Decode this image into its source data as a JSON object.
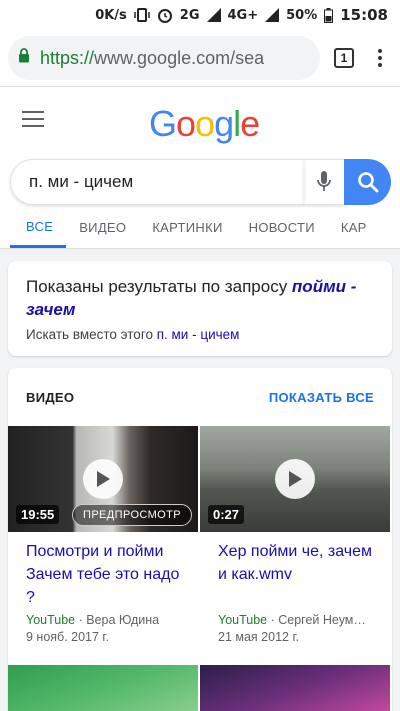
{
  "status": {
    "speed": "0K/s",
    "net1": "2G",
    "net2": "4G+",
    "battery": "50%",
    "time": "15:08"
  },
  "chrome": {
    "url_scheme": "https://",
    "url_rest": "www.google.com/sea",
    "tab_count": "1"
  },
  "search": {
    "query": "п. ми - цичем"
  },
  "tabs": [
    {
      "label": "ВСЕ"
    },
    {
      "label": "ВИДЕО"
    },
    {
      "label": "КАРТИНКИ"
    },
    {
      "label": "НОВОСТИ"
    },
    {
      "label": "КАР"
    }
  ],
  "spell": {
    "prefix": "Показаны результаты по запросу ",
    "corrected_1": "пойми",
    "corrected_2": "- зачем",
    "alt_prefix": "Искать вместо этого ",
    "alt_query": "п. ми - цичем"
  },
  "videos": {
    "heading": "ВИДЕО",
    "show_all": "ПОКАЗАТЬ ВСЕ",
    "items": [
      {
        "duration": "19:55",
        "preview": "ПРЕДПРОСМОТР",
        "title": "Посмотри и пойми Зачем тебе это надо ?",
        "source": "YouTube",
        "author": " · Вера Юдина",
        "date": "9 нояб. 2017 г."
      },
      {
        "duration": "0:27",
        "title": "Хер пойми че, зачем и как.wmv",
        "source": "YouTube",
        "author": " · Сергей Неум…",
        "date": "21 мая 2012 г."
      }
    ]
  },
  "colors": {
    "accent": "#1a73e8",
    "link": "#1a0dab",
    "source_green": "#188038"
  }
}
